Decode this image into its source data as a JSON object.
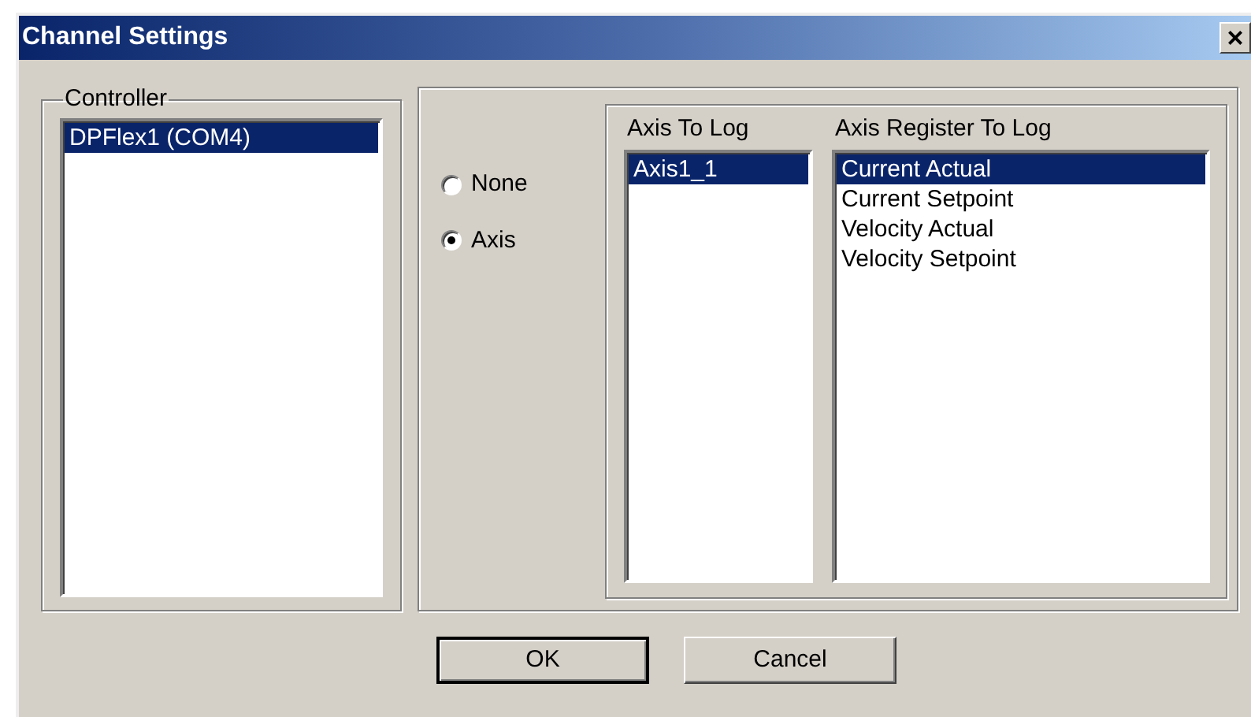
{
  "window": {
    "title": "Channel Settings",
    "close": "×"
  },
  "controller": {
    "label": "Controller",
    "items": [
      {
        "label": "DPFlex1 (COM4)",
        "selected": true
      }
    ]
  },
  "log_mode": [
    {
      "label": "None",
      "selected": false
    },
    {
      "label": "Axis",
      "selected": true
    }
  ],
  "axis_to_log": {
    "label": "Axis To Log",
    "items": [
      {
        "label": "Axis1_1",
        "selected": true
      }
    ]
  },
  "axis_register_to_log": {
    "label": "Axis Register To Log",
    "items": [
      {
        "label": "Current Actual",
        "selected": true
      },
      {
        "label": "Current Setpoint",
        "selected": false
      },
      {
        "label": "Velocity Actual",
        "selected": false
      },
      {
        "label": "Velocity Setpoint",
        "selected": false
      }
    ]
  },
  "buttons": [
    {
      "label": "OK",
      "default": true
    },
    {
      "label": "Cancel",
      "default": false
    }
  ]
}
